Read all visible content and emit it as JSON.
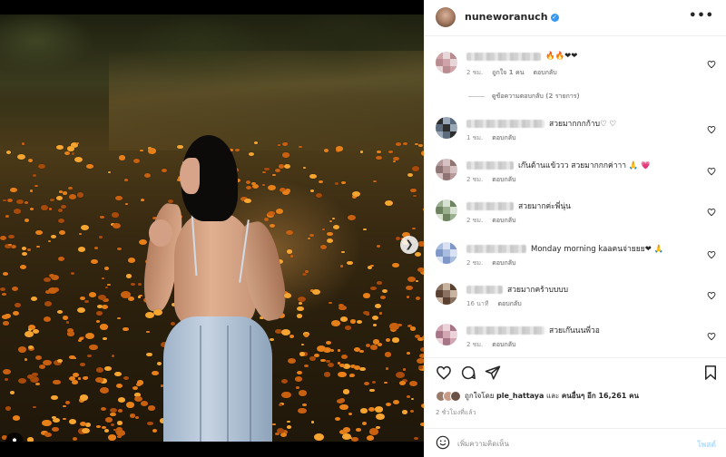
{
  "post": {
    "username": "nuneworanuch",
    "verified_icon": "verified-badge-icon",
    "more_icon": "more-horizontal-icon"
  },
  "comments": [
    {
      "text": "🔥🔥❤❤",
      "time": "2 ชม.",
      "likes": "ถูกใจ 1 คน",
      "reply": "ตอบกลับ",
      "avatar_colors": [
        "#cfa3a8",
        "#e8d7d9",
        "#b88c91"
      ]
    },
    {
      "text": "สวยมากกกก้าบ♡ ♡",
      "time": "1 ชม.",
      "reply": "ตอบกลับ",
      "avatar_colors": [
        "#2d2d2d",
        "#9aa7b6",
        "#5c6b7d"
      ]
    },
    {
      "text": "เก๊นต้านแข้ววว สวยมากกกค่าาา 🙏 💗",
      "time": "2 ชม.",
      "reply": "ตอบกลับ",
      "avatar_colors": [
        "#b79a9a",
        "#d6c2c2",
        "#8f7474"
      ]
    },
    {
      "text": "สวยมากค่ะพี่นุ่น",
      "time": "2 ชม.",
      "reply": "ตอบกลับ",
      "avatar_colors": [
        "#9bb08f",
        "#d9e2d2",
        "#6e8460"
      ]
    },
    {
      "text": "Monday morning kaaคนจ่ายยย❤ 🙏",
      "time": "2 ชม.",
      "reply": "ตอบกลับ",
      "avatar_colors": [
        "#a9bde0",
        "#d8e2f2",
        "#7f98c7"
      ]
    },
    {
      "text": "สวยมากคร้าบบบบ",
      "time": "16 นาที",
      "reply": "ตอบกลับ",
      "avatar_colors": [
        "#8a7060",
        "#c8b2a0",
        "#5a4030"
      ]
    },
    {
      "text": "สวยเก๊นนนพี่วอ",
      "time": "2 ชม.",
      "reply": "ตอบกลับ",
      "avatar_colors": [
        "#d2a6b3",
        "#ecd3da",
        "#a77686"
      ]
    }
  ],
  "view_replies": "ดูข้อความตอบกลับ (2 รายการ)",
  "likes": {
    "prefix": "ถูกใจโดย",
    "user": "ple_hattaya",
    "middle": "และ",
    "others": "คนอื่นๆ อีก 16,261 คน"
  },
  "timeago": "2 ชั่วโมงที่แล้ว",
  "add_comment": {
    "placeholder": "เพิ่มความคิดเห็น",
    "post_label": "โพสต์"
  },
  "carousel": {
    "total": 3,
    "active": 1
  },
  "colors": {
    "accent": "#3897f0",
    "post_disabled": "#b2dffc",
    "heart": "#ed1b34"
  }
}
